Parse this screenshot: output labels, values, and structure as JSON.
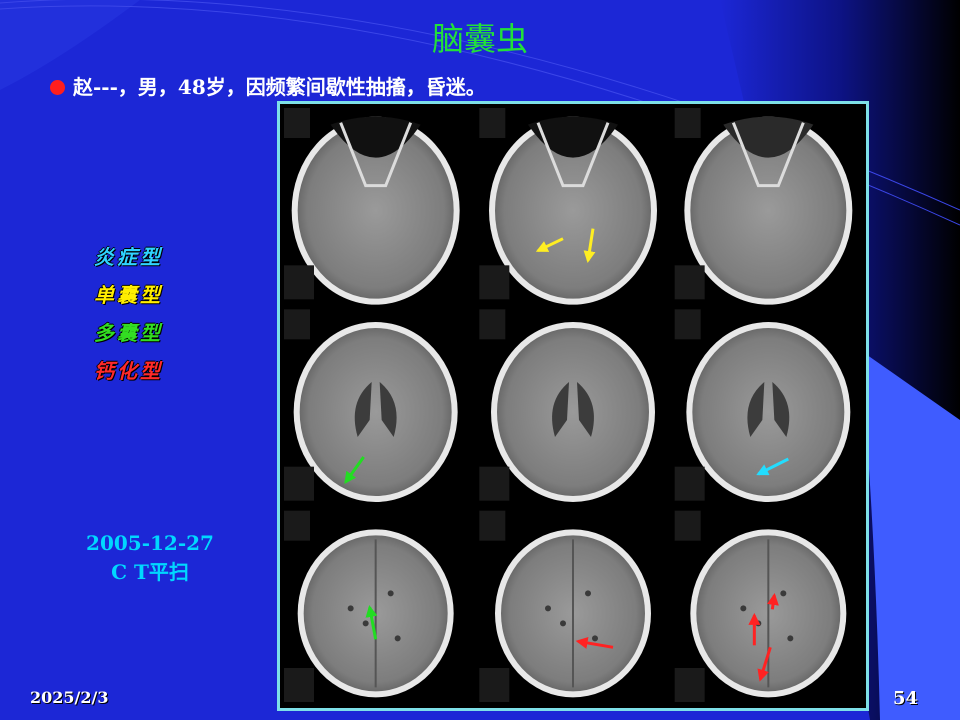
{
  "slide": {
    "title": "脑囊虫",
    "patient_line": "赵---，男，48岁，因频繁间歇性抽搐，昏迷。",
    "types": [
      {
        "label": "炎症型",
        "color": "#2fd3ff"
      },
      {
        "label": "单囊型",
        "color": "#ffee00"
      },
      {
        "label": "多囊型",
        "color": "#33dd22"
      },
      {
        "label": "钙化型",
        "color": "#ff2a2a"
      }
    ],
    "scan_date": "2005-12-27",
    "scan_type": "C T平扫",
    "footer_date": "2025/2/3",
    "page_number": "54"
  },
  "colors": {
    "background": "#1c27d6",
    "title": "#22e03a",
    "accent_bullet": "#ff1e1e",
    "frame_border": "#7ee0e8",
    "arrow_yellow": "#ffee22",
    "arrow_green": "#22dd22",
    "arrow_cyan": "#22ddff",
    "arrow_red": "#ff2222"
  },
  "ct_image": {
    "description_icon": "brain-ct-grid-3x3",
    "panels": [
      {
        "arrows": []
      },
      {
        "arrows": [
          "yellow",
          "yellow"
        ]
      },
      {
        "arrows": []
      },
      {
        "arrows": [
          "green"
        ]
      },
      {
        "arrows": []
      },
      {
        "arrows": [
          "cyan"
        ]
      },
      {
        "arrows": [
          "green"
        ]
      },
      {
        "arrows": [
          "red"
        ]
      },
      {
        "arrows": [
          "red",
          "red",
          "red"
        ]
      }
    ]
  }
}
